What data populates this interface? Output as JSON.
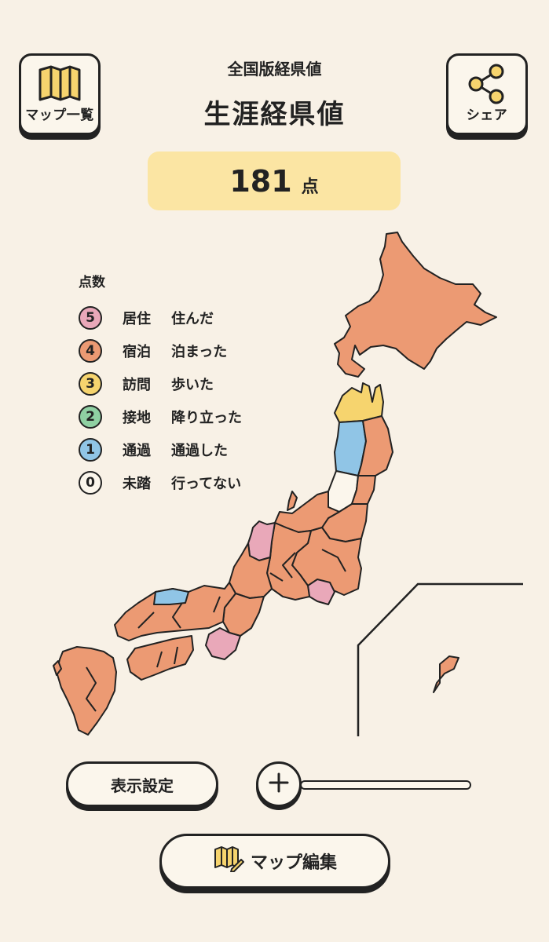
{
  "header": {
    "subtitle": "全国版経県値",
    "title": "生涯経県値",
    "map_list_label": "マップ一覧",
    "share_label": "シェア"
  },
  "score": {
    "value": "181",
    "unit": "点"
  },
  "legend": {
    "title": "点数",
    "items": [
      {
        "num": "5",
        "name": "居住",
        "desc": "住んだ",
        "color": "#e9a8b9"
      },
      {
        "num": "4",
        "name": "宿泊",
        "desc": "泊まった",
        "color": "#ec9a73"
      },
      {
        "num": "3",
        "name": "訪問",
        "desc": "歩いた",
        "color": "#f6d46e"
      },
      {
        "num": "2",
        "name": "接地",
        "desc": "降り立った",
        "color": "#8fd0a2"
      },
      {
        "num": "1",
        "name": "通過",
        "desc": "通過した",
        "color": "#90c5e6"
      },
      {
        "num": "0",
        "name": "未踏",
        "desc": "行ってない",
        "color": "#fbf6ec"
      }
    ]
  },
  "controls": {
    "display_settings_label": "表示設定",
    "zoom_icon": "plus-icon",
    "edit_map_label": "マップ編集"
  },
  "colors": {
    "background": "#f8f1e6",
    "score_bg": "#fbe5a3",
    "lived": "#e9a8b9",
    "stayed": "#ec9a73",
    "visited": "#f6d46e",
    "landed": "#8fd0a2",
    "passed": "#90c5e6",
    "unvisited": "#fbf6ec"
  }
}
